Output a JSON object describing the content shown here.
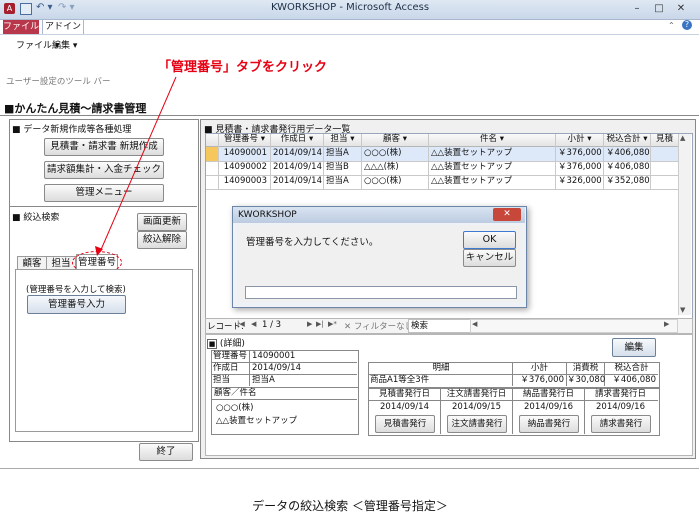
{
  "titlebar": {
    "title": "KWORKSHOP - Microsoft Access"
  },
  "ribbon": {
    "tabs": [
      "ファイル",
      "アドイン"
    ],
    "menus": [
      "ファイル ▾",
      "編集 ▾"
    ],
    "toolbar_label": "ユーザー設定のツール バー"
  },
  "annotation": {
    "callout": "「管理番号」タブをクリック"
  },
  "form": {
    "title": "■かんたん見積～請求書管理"
  },
  "left": {
    "section1_title": "■ データ新規作成等各種処理",
    "buttons": [
      "見積書・請求書 新規作成",
      "請求額集計・入金チェック",
      "管理メニュー"
    ],
    "section2_title": "■ 絞込検索",
    "refresh_btn": "画面更新",
    "clear_btn": "絞込解除",
    "tabs": [
      "顧客",
      "担当",
      "管理番号"
    ],
    "hint": "(管理番号を入力して検索)",
    "input_btn": "管理番号入力",
    "close_btn": "終了"
  },
  "datasheet": {
    "title": "■ 見積書・請求書発行用データ一覧",
    "headers": [
      "管理番号 ▾",
      "作成日 ▾",
      "担当 ▾",
      "顧客 ▾",
      "件名 ▾",
      "小計 ▾",
      "税込合計 ▾",
      "見積"
    ],
    "rows": [
      [
        "14090001",
        "2014/09/14",
        "担当A",
        "○○○(株)",
        "△△装置セットアップ",
        "￥376,000",
        "￥406,080"
      ],
      [
        "14090002",
        "2014/09/14",
        "担当B",
        "△△△(株)",
        "△△装置セットアップ",
        "￥376,000",
        "￥406,080"
      ],
      [
        "14090003",
        "2014/09/14",
        "担当A",
        "○○○(株)",
        "△△装置セットアップ",
        "￥326,000",
        "￥352,080"
      ]
    ],
    "nav": {
      "label": "レコード:",
      "first": "|◀",
      "prev": "◀",
      "current": "1 / 3",
      "next": "▶",
      "last": "▶|",
      "new": "▶*",
      "filter": "フィルターなし",
      "search": "検索"
    }
  },
  "dialog": {
    "title": "KWORKSHOP",
    "message": "管理番号を入力してください。",
    "ok": "OK",
    "cancel": "キャンセル",
    "input_value": ""
  },
  "detail": {
    "title": "(詳細)",
    "edit_btn": "編集",
    "fields": [
      {
        "label": "管理番号",
        "value": "14090001"
      },
      {
        "label": "作成日",
        "value": "2014/09/14"
      },
      {
        "label": "担当",
        "value": "担当A"
      }
    ],
    "customer_header": "顧客／件名",
    "customer": "○○○(株)",
    "subject": "△△装置セットアップ",
    "meisai": {
      "header": "明細",
      "col_headers": [
        "小計",
        "消費税",
        "税込合計"
      ],
      "item": "商品A1等全3件",
      "values": [
        "￥376,000",
        "￥30,080",
        "￥406,080"
      ]
    },
    "dates": {
      "headers": [
        "見積書発行日",
        "注文請書発行日",
        "納品書発行日",
        "請求書発行日"
      ],
      "values": [
        "2014/09/14",
        "2014/09/15",
        "2014/09/16",
        "2014/09/16"
      ],
      "buttons": [
        "見積書発行",
        "注文請書発行",
        "納品書発行",
        "請求書発行"
      ]
    }
  },
  "caption": "データの絞込検索 ＜管理番号指定＞",
  "colors": {
    "accent_red": "#e60012",
    "file_tab": "#b9374a",
    "selected_row": "#dde8f8",
    "dialog_close": "#c7473a"
  }
}
